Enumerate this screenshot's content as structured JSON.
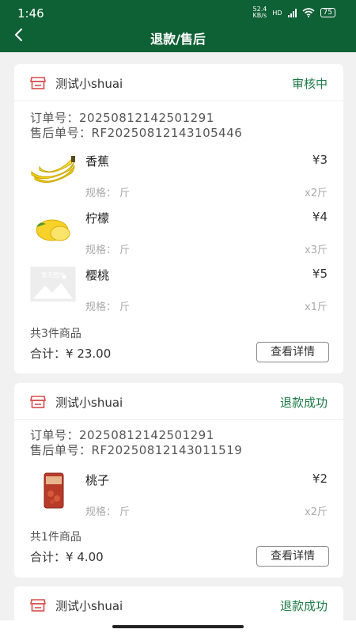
{
  "status_bar": {
    "time": "1:46",
    "net_speed_top": "52.4",
    "net_speed_bottom": "KB/s",
    "signal_label": "HD",
    "battery": "75"
  },
  "header": {
    "title": "退款/售后"
  },
  "orders": [
    {
      "store": "测试小shuai",
      "status": "审核中",
      "status_color": "#1c7a45",
      "order_no_label": "订单号：",
      "order_no": "20250812142501291",
      "aftersale_no_label": "售后单号：",
      "aftersale_no": "RF20250812143105446",
      "items": [
        {
          "name": "香蕉",
          "price": "¥3",
          "spec_label": "规格：",
          "spec": "斤",
          "qty": "x2斤",
          "icon": "banana-image"
        },
        {
          "name": "柠檬",
          "price": "¥4",
          "spec_label": "规格：",
          "spec": "斤",
          "qty": "x3斤",
          "icon": "lemon-image"
        },
        {
          "name": "樱桃",
          "price": "¥5",
          "spec_label": "规格：",
          "spec": "斤",
          "qty": "x1斤",
          "icon": "placeholder-image",
          "placeholder_text": "暂无图片"
        }
      ],
      "count_text": "共3件商品",
      "total_label": "合计：",
      "total": "¥ 23.00",
      "detail_button": "查看详情"
    },
    {
      "store": "测试小shuai",
      "status": "退款成功",
      "status_color": "#1c7a45",
      "order_no_label": "订单号：",
      "order_no": "20250812142501291",
      "aftersale_no_label": "售后单号：",
      "aftersale_no": "RF20250812143011519",
      "items": [
        {
          "name": "桃子",
          "price": "¥2",
          "spec_label": "规格：",
          "spec": "斤",
          "qty": "x2斤",
          "icon": "peach-package-image"
        }
      ],
      "count_text": "共1件商品",
      "total_label": "合计：",
      "total": "¥ 4.00",
      "detail_button": "查看详情"
    },
    {
      "store": "测试小shuai",
      "status": "退款成功",
      "status_color": "#1c7a45"
    }
  ],
  "colors": {
    "header_bg": "#0e6035",
    "accent": "#1c7a45",
    "store_icon": "#d94b4b"
  }
}
